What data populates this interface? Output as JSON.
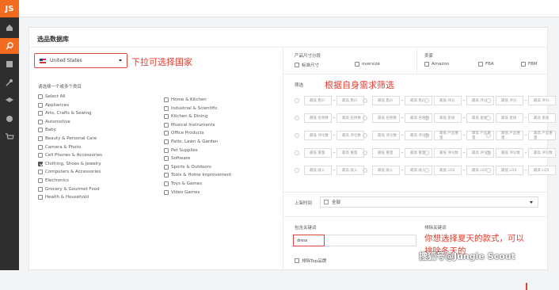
{
  "app": {
    "logo": "JS"
  },
  "sidebar": {
    "icons": [
      "home-icon",
      "search-icon",
      "book-icon",
      "key-icon",
      "graduation-icon",
      "globe-icon",
      "cart-icon"
    ]
  },
  "page": {
    "title": "选品数据库"
  },
  "country": {
    "selected": "United States"
  },
  "annotations": {
    "country_note": "下拉可选择国家",
    "filter_note": "根据自身需求筛选",
    "keyword_note_line1": "你想选择夏天的款式，可以",
    "keyword_note_line2": "排除冬天的"
  },
  "categories": {
    "label": "请选择一个或多个类目",
    "left": [
      {
        "name": "Select All",
        "checked": false
      },
      {
        "name": "Appliances",
        "checked": false
      },
      {
        "name": "Arts, Crafts & Sewing",
        "checked": false
      },
      {
        "name": "Automotive",
        "checked": false
      },
      {
        "name": "Baby",
        "checked": false
      },
      {
        "name": "Beauty & Personal Care",
        "checked": false
      },
      {
        "name": "Camera & Photo",
        "checked": false
      },
      {
        "name": "Cell Phones & Accessories",
        "checked": false
      },
      {
        "name": "Clothing, Shoes & Jewelry",
        "checked": true
      },
      {
        "name": "Computers & Accessories",
        "checked": false
      },
      {
        "name": "Electronics",
        "checked": false
      },
      {
        "name": "Grocery & Gourmet Food",
        "checked": false
      },
      {
        "name": "Health & Household",
        "checked": false
      }
    ],
    "right": [
      {
        "name": "Home & Kitchen",
        "checked": false
      },
      {
        "name": "Industrial & Scientific",
        "checked": false
      },
      {
        "name": "Kitchen & Dining",
        "checked": false
      },
      {
        "name": "Musical Instruments",
        "checked": false
      },
      {
        "name": "Office Products",
        "checked": false
      },
      {
        "name": "Patio, Lawn & Garden",
        "checked": false
      },
      {
        "name": "Pet Supplies",
        "checked": false
      },
      {
        "name": "Software",
        "checked": false
      },
      {
        "name": "Sports & Outdoors",
        "checked": false
      },
      {
        "name": "Tools & Home Improvement",
        "checked": false
      },
      {
        "name": "Toys & Games",
        "checked": false
      },
      {
        "name": "Video Games",
        "checked": false
      }
    ]
  },
  "size_tier": {
    "label": "产品尺寸分段",
    "options": [
      "标准尺寸",
      "oversize"
    ]
  },
  "seller": {
    "label": "卖家",
    "options": [
      "Amazon",
      "FBA",
      "FBM"
    ]
  },
  "filter": {
    "label": "筛选",
    "min": "最低",
    "max": "最高",
    "left_metrics": [
      "售价",
      "名称数",
      "评论数",
      "重量",
      "收入"
    ],
    "right_metrics": [
      "评分",
      "星级",
      "产品重量",
      "评论数",
      "LQS"
    ]
  },
  "listing_date": {
    "label": "上架时间",
    "value": "全部"
  },
  "include_kw": {
    "label": "包含关键词",
    "value": "dress"
  },
  "exclude_kw": {
    "label": "排除关键词"
  },
  "exclude_top": {
    "label": "排除Top品牌"
  },
  "watermark": "搜狐号@Jungle Scout"
}
